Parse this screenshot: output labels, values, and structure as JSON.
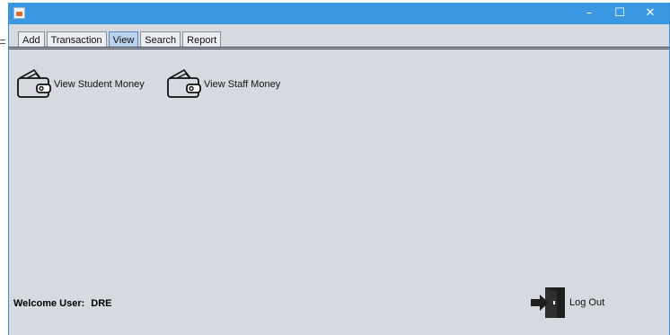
{
  "window": {
    "title": ""
  },
  "tabs": [
    {
      "label": "Add"
    },
    {
      "label": "Transaction"
    },
    {
      "label": "View"
    },
    {
      "label": "Search"
    },
    {
      "label": "Report"
    }
  ],
  "selected_tab": "View",
  "view": {
    "student_money_label": "View Student Money",
    "staff_money_label": "View Staff Money"
  },
  "footer": {
    "welcome_prefix": "Welcome User:",
    "username": "DRE",
    "logout_label": "Log Out"
  },
  "colors": {
    "titlebar": "#3a97e2",
    "background": "#d6d9e0",
    "selected_tab": "#b9d2ee"
  },
  "icons": {
    "window_controls": [
      "minimize-icon",
      "maximize-icon",
      "close-icon"
    ],
    "view_icons": [
      "wallet-icon",
      "wallet-icon"
    ],
    "logout_icon": "exit-door-icon"
  }
}
